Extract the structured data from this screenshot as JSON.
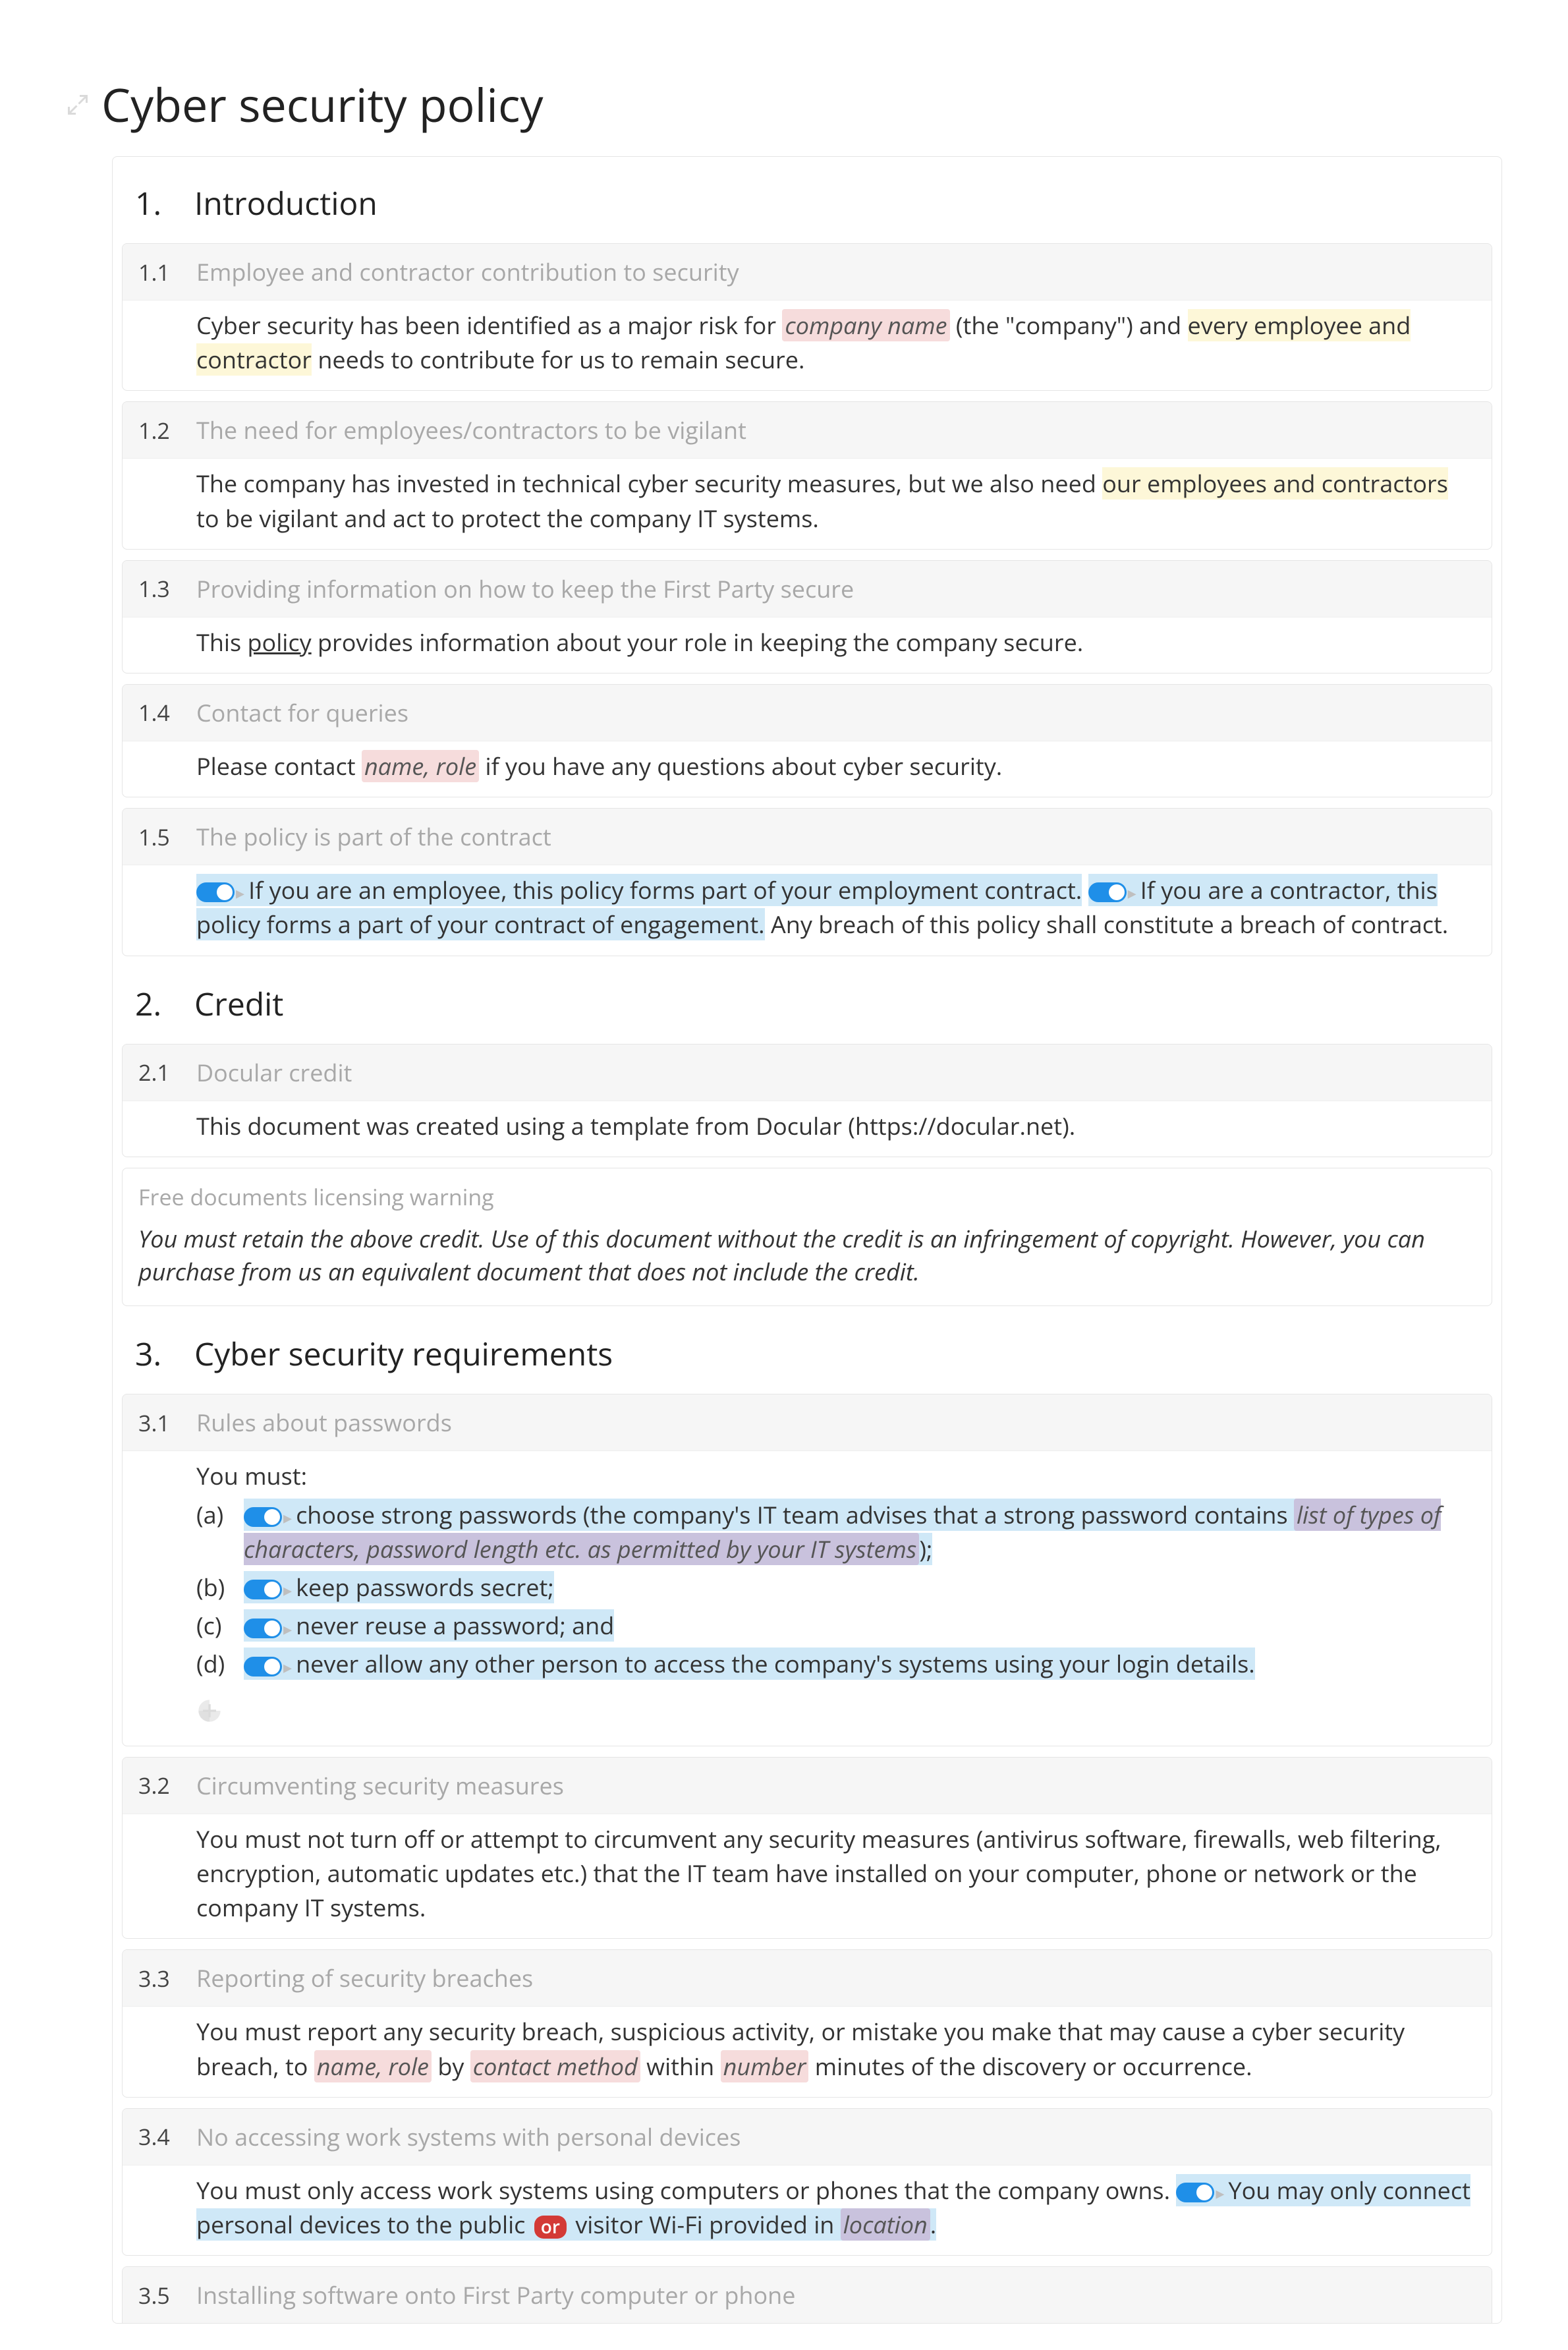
{
  "title": "Cyber security policy",
  "sections": [
    {
      "number": "1.",
      "title": "Introduction",
      "subs": [
        {
          "num": "1.1",
          "heading": "Employee and contractor contribution to security",
          "body": {
            "pre": "Cyber security has been identified as a major risk for ",
            "ph1": "company name",
            "mid1": " (the \"company\") and ",
            "hl1": "every employee and contractor",
            "post": " needs to contribute for us to remain secure."
          }
        },
        {
          "num": "1.2",
          "heading": "The need for employees/contractors to be vigilant",
          "body": {
            "pre": "The company has invested in technical cyber security measures, but we also need ",
            "hl1": "our employees and contractors",
            "post": " to be vigilant and act to protect the company IT systems."
          }
        },
        {
          "num": "1.3",
          "heading": "Providing information on how to keep the First Party secure",
          "body": {
            "pre": "This ",
            "link": "policy",
            "post": " provides information about your role in keeping the company secure."
          }
        },
        {
          "num": "1.4",
          "heading": "Contact for queries",
          "body": {
            "pre": "Please contact ",
            "ph1": "name, role",
            "post": " if you have any questions about cyber security."
          }
        },
        {
          "num": "1.5",
          "heading": "The policy is part of the contract",
          "body": {
            "t1": "If you are an employee, this policy forms part of your employment contract.",
            "t2": "If you are a contractor, this policy forms a part of your contract of engagement.",
            "post": " Any breach of this policy shall constitute a breach of contract."
          }
        }
      ]
    },
    {
      "number": "2.",
      "title": "Credit",
      "subs": [
        {
          "num": "2.1",
          "heading": "Docular credit",
          "body": {
            "text": "This document was created using a template from Docular (https://docular.net)."
          }
        }
      ],
      "warning": {
        "title": "Free documents licensing warning",
        "body": "You must retain the above credit. Use of this document without the credit is an infringement of copyright. However, you can purchase from us an equivalent document that does not include the credit."
      }
    },
    {
      "number": "3.",
      "title": "Cyber security requirements",
      "subs": [
        {
          "num": "3.1",
          "heading": "Rules about passwords",
          "intro": "You must:",
          "items": [
            {
              "label": "(a)",
              "toggle": true,
              "pre": "choose strong passwords (the company's IT team advises that a strong password contains ",
              "ph": "list of types of characters, password length etc. as permitted by your IT systems",
              "post": ");"
            },
            {
              "label": "(b)",
              "toggle": true,
              "text": "keep passwords secret;"
            },
            {
              "label": "(c)",
              "toggle": true,
              "text": "never reuse a password; and"
            },
            {
              "label": "(d)",
              "toggle": true,
              "text": "never allow any other person to access the company's systems using your login details."
            }
          ]
        },
        {
          "num": "3.2",
          "heading": "Circumventing security measures",
          "body": {
            "text": "You must not turn off or attempt to circumvent any security measures (antivirus software, firewalls, web filtering, encryption, automatic updates etc.) that the IT team have installed on your computer, phone or network or the company IT systems."
          }
        },
        {
          "num": "3.3",
          "heading": "Reporting of security breaches",
          "body": {
            "pre": "You must report any security breach, suspicious activity, or mistake you make that may cause a cyber security breach, to ",
            "ph1": "name, role",
            "mid1": " by ",
            "ph2": "contact method",
            "mid2": " within ",
            "ph3": "number",
            "post": " minutes of the discovery or occurrence."
          }
        },
        {
          "num": "3.4",
          "heading": "No accessing work systems with personal devices",
          "body": {
            "pre": "You must only access work systems using computers or phones that the company owns. ",
            "t_pre": "You may only connect personal devices to the public ",
            "or": "or",
            "t_mid": " visitor Wi-Fi provided in ",
            "ph": "location",
            "t_post": "."
          }
        },
        {
          "num": "3.5",
          "heading": "Installing software onto First Party computer or phone"
        }
      ]
    }
  ]
}
